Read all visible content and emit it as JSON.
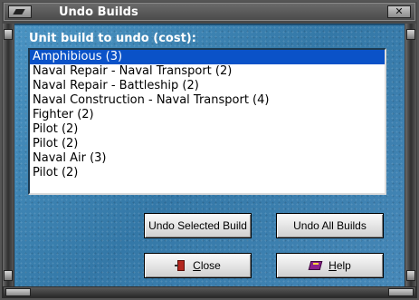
{
  "window": {
    "title": "Undo Builds",
    "close_glyph": "✕",
    "client_color": "#3b84b4"
  },
  "prompt_label": "Unit build to undo (cost):",
  "list": {
    "selected_index": 0,
    "items": [
      {
        "label": "Amphibious (3)"
      },
      {
        "label": "Naval Repair - Naval Transport (2)"
      },
      {
        "label": "Naval Repair - Battleship (2)"
      },
      {
        "label": "Naval Construction - Naval Transport (4)"
      },
      {
        "label": "Fighter (2)"
      },
      {
        "label": "Pilot (2)"
      },
      {
        "label": "Pilot (2)"
      },
      {
        "label": "Naval Air (3)"
      },
      {
        "label": "Pilot (2)"
      }
    ]
  },
  "buttons": {
    "undo_selected": "Undo Selected Build",
    "undo_all": "Undo All Builds",
    "close_first": "C",
    "close_rest": "lose",
    "help_first": "H",
    "help_rest": "elp"
  },
  "icons": {
    "close_icon": "door-exit-icon",
    "help_icon": "book-icon"
  }
}
